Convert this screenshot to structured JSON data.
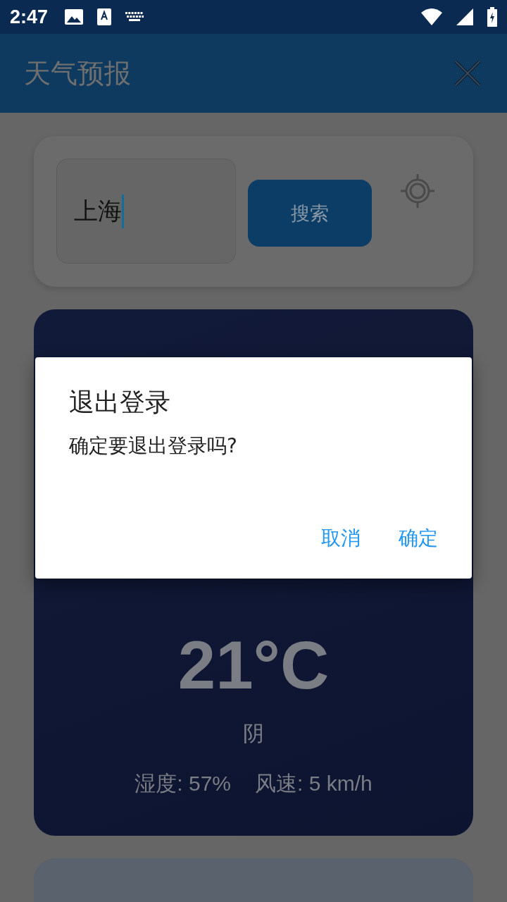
{
  "status_bar": {
    "time": "2:47"
  },
  "app_bar": {
    "title": "天气预报"
  },
  "search": {
    "value": "上海",
    "button": "搜索"
  },
  "weather": {
    "temperature": "21°C",
    "condition": "阴",
    "humidity": "湿度: 57%",
    "wind": "风速: 5 km/h"
  },
  "dialog": {
    "title": "退出登录",
    "message": "确定要退出登录吗?",
    "buttons": [
      "取消",
      "确定"
    ]
  }
}
